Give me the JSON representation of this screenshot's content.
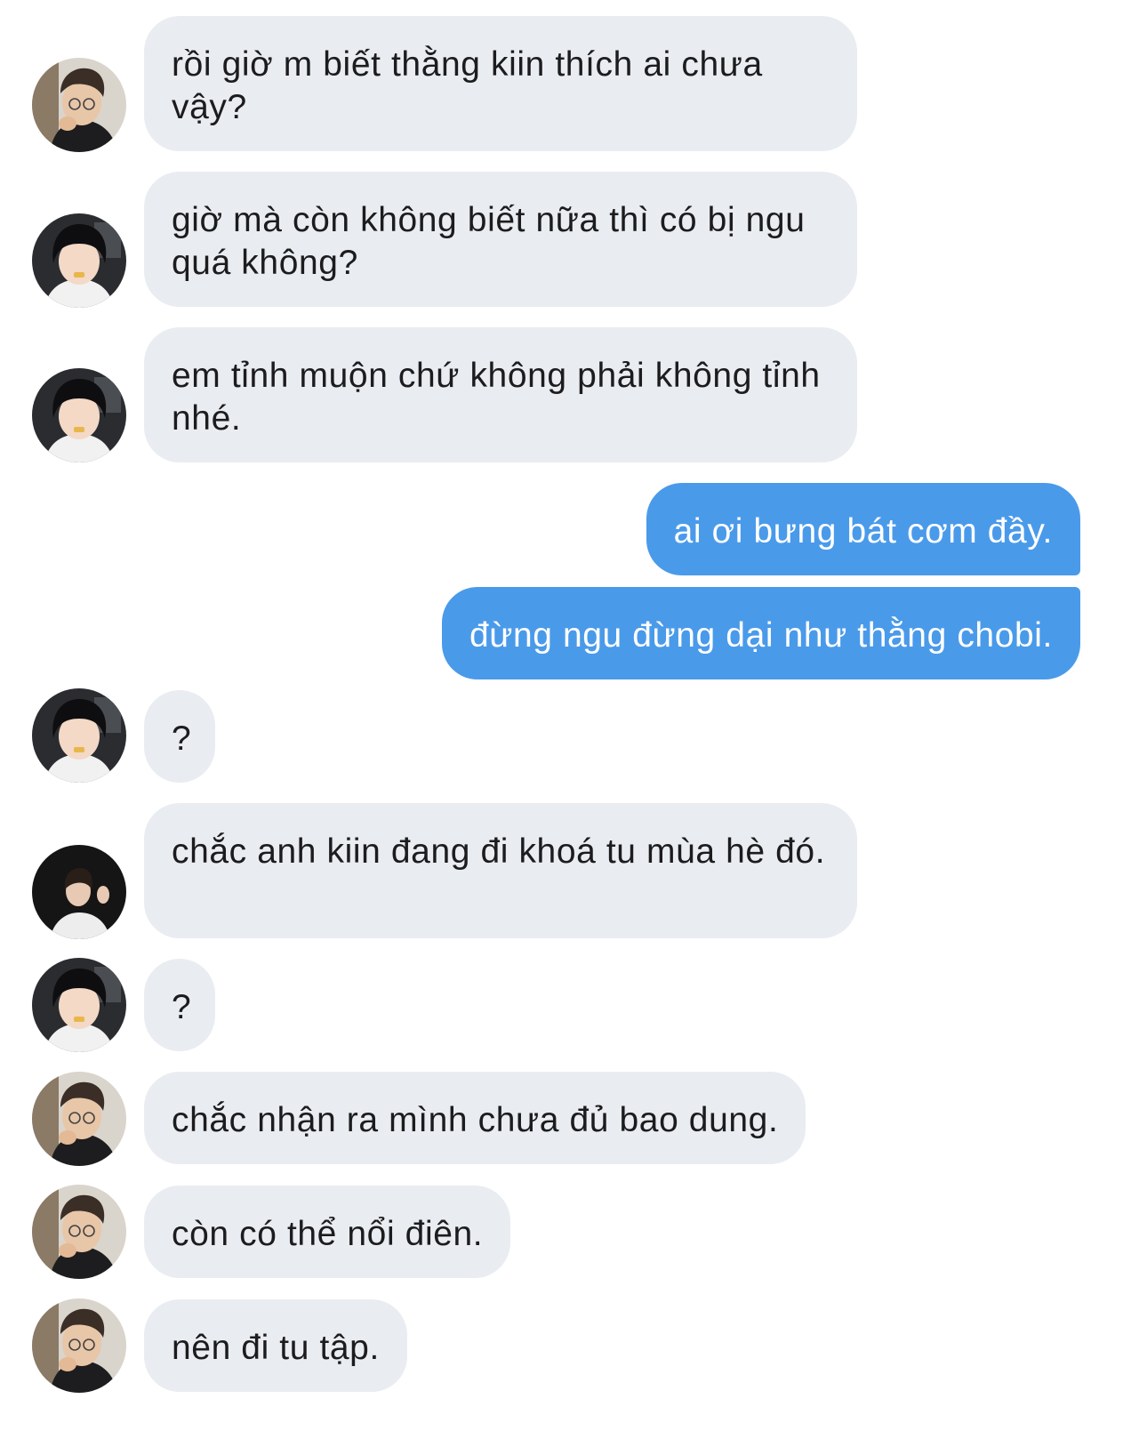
{
  "colors": {
    "incoming_bubble": "#e9ecf0",
    "outgoing_bubble": "#4a9aea",
    "incoming_text": "#1c1c1e",
    "outgoing_text": "#ffffff"
  },
  "messages": [
    {
      "direction": "incoming",
      "sender_avatar": "avatar-a",
      "text": "rồi giờ m biết thằng kiin thích ai chưa vậy?"
    },
    {
      "direction": "incoming",
      "sender_avatar": "avatar-b",
      "text": "giờ mà còn không biết nữa thì có bị ngu quá không?"
    },
    {
      "direction": "incoming",
      "sender_avatar": "avatar-b",
      "text": "em tỉnh muộn chứ không phải không tỉnh nhé."
    },
    {
      "direction": "outgoing",
      "text": "ai ơi bưng bát cơm đầy."
    },
    {
      "direction": "outgoing",
      "text": "đừng ngu đừng dại như thằng chobi."
    },
    {
      "direction": "incoming",
      "sender_avatar": "avatar-b",
      "text": "?"
    },
    {
      "direction": "incoming",
      "sender_avatar": "avatar-c",
      "text": "chắc anh kiin đang đi khoá tu mùa hè đó."
    },
    {
      "direction": "incoming",
      "sender_avatar": "avatar-b",
      "text": "?"
    },
    {
      "direction": "incoming",
      "sender_avatar": "avatar-a",
      "text": "chắc nhận ra mình chưa đủ bao dung."
    },
    {
      "direction": "incoming",
      "sender_avatar": "avatar-a",
      "text": "còn có thể nổi điên."
    },
    {
      "direction": "incoming",
      "sender_avatar": "avatar-a",
      "text": "nên đi tu tập."
    }
  ]
}
